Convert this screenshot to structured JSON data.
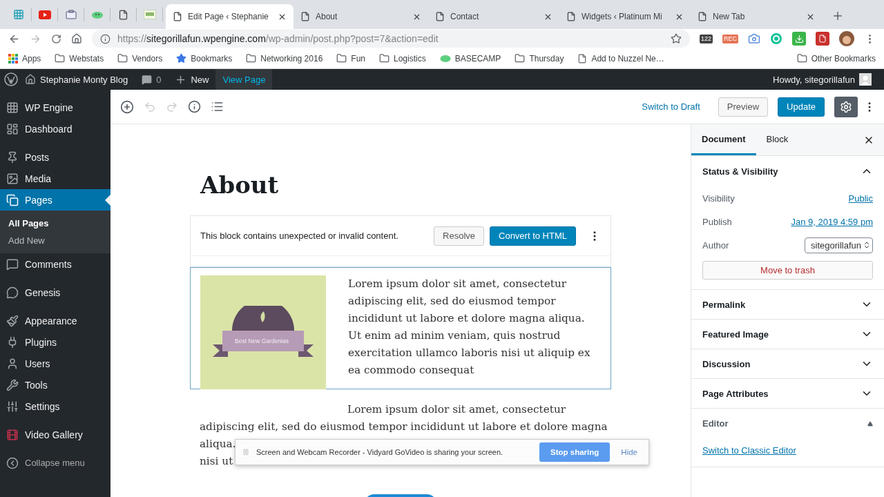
{
  "browser": {
    "tabs": [
      {
        "title": "Edit Page ‹ Stephanie",
        "selected": true
      },
      {
        "title": "About",
        "selected": false
      },
      {
        "title": "Contact",
        "selected": false
      },
      {
        "title": "Widgets ‹ Platinum Mi",
        "selected": false
      },
      {
        "title": "New Tab",
        "selected": false
      }
    ],
    "url": {
      "scheme": "https://",
      "host": "sitegorillafun.wpengine.com",
      "path": "/wp-admin/post.php?post=7&action=edit"
    },
    "extension_badges": [
      "122",
      "REC"
    ],
    "bookmarks": [
      {
        "label": "Apps",
        "kind": "apps"
      },
      {
        "label": "Webstats",
        "kind": "folder"
      },
      {
        "label": "Vendors",
        "kind": "folder"
      },
      {
        "label": "Bookmarks",
        "kind": "star"
      },
      {
        "label": "Networking 2016",
        "kind": "folder"
      },
      {
        "label": "Fun",
        "kind": "folder"
      },
      {
        "label": "Logistics",
        "kind": "folder"
      },
      {
        "label": "BASECAMP",
        "kind": "basecamp"
      },
      {
        "label": "Thursday",
        "kind": "folder"
      },
      {
        "label": "Add to Nuzzel Ne…",
        "kind": "page"
      }
    ],
    "other_bookmarks": "Other Bookmarks"
  },
  "admin_bar": {
    "site": "Stephanie Monty Blog",
    "comments": "0",
    "new": "New",
    "view": "View Page",
    "howdy": "Howdy, sitegorillafun"
  },
  "sidebar": {
    "groups": [
      [
        {
          "label": "WP Engine",
          "selected": false
        },
        {
          "label": "Dashboard",
          "selected": false
        }
      ],
      [
        {
          "label": "Posts",
          "selected": false
        },
        {
          "label": "Media",
          "selected": false
        },
        {
          "label": "Pages",
          "selected": true,
          "children": [
            {
              "label": "All Pages",
              "selected": true
            },
            {
              "label": "Add New",
              "selected": false
            }
          ]
        },
        {
          "label": "Comments",
          "selected": false
        }
      ],
      [
        {
          "label": "Genesis",
          "selected": false
        }
      ],
      [
        {
          "label": "Appearance",
          "selected": false
        },
        {
          "label": "Plugins",
          "selected": false
        },
        {
          "label": "Users",
          "selected": false
        },
        {
          "label": "Tools",
          "selected": false
        },
        {
          "label": "Settings",
          "selected": false
        }
      ],
      [
        {
          "label": "Video Gallery",
          "selected": false
        }
      ]
    ],
    "collapse": "Collapse menu"
  },
  "toolbar": {
    "undo_disabled": true,
    "redo_disabled": true,
    "switch_to_draft": "Switch to Draft",
    "preview": "Preview",
    "update": "Update"
  },
  "document": {
    "title": "About",
    "warning": {
      "message": "This block contains unexpected or invalid content.",
      "resolve": "Resolve",
      "convert": "Convert to HTML"
    },
    "media_text": {
      "banner": "Best New Gardenias",
      "text": "Lorem ipsum dolor sit amet, consectetur adipiscing elit, sed do eiusmod tempor incididunt ut labore et dolore magna aliqua. Ut enim ad minim veniam, quis nostrud exercitation ullamco laboris nisi ut aliquip ex ea commodo consequat"
    },
    "paragraph_lines": [
      "Lorem ipsum dolor sit amet, consectetur",
      "adipiscing elit, sed do eiusmod tempor incididunt ut labore et dolore magna",
      "aliqua.",
      "nisi ut"
    ]
  },
  "sharing_bar": {
    "message": "Screen and Webcam Recorder - Vidyard GoVideo is sharing your screen.",
    "stop": "Stop sharing",
    "hide": "Hide"
  },
  "settings_panel": {
    "tabs": [
      {
        "label": "Document",
        "selected": true
      },
      {
        "label": "Block",
        "selected": false
      }
    ],
    "status": {
      "title": "Status & Visibility",
      "expanded": true,
      "rows": [
        {
          "label": "Visibility",
          "value": "Public",
          "kind": "link"
        },
        {
          "label": "Publish",
          "value": "Jan 9, 2019 4:59 pm",
          "kind": "link"
        },
        {
          "label": "Author",
          "value": "sitegorillafun",
          "kind": "select"
        }
      ],
      "trash": "Move to trash"
    },
    "sections": [
      {
        "title": "Permalink",
        "expanded": false,
        "kind": "panel"
      },
      {
        "title": "Featured Image",
        "expanded": false,
        "kind": "panel"
      },
      {
        "title": "Discussion",
        "expanded": false,
        "kind": "panel"
      },
      {
        "title": "Page Attributes",
        "expanded": false,
        "kind": "panel"
      },
      {
        "title": "Editor",
        "expanded": true,
        "kind": "plugin",
        "link": "Switch to Classic Editor"
      }
    ]
  }
}
